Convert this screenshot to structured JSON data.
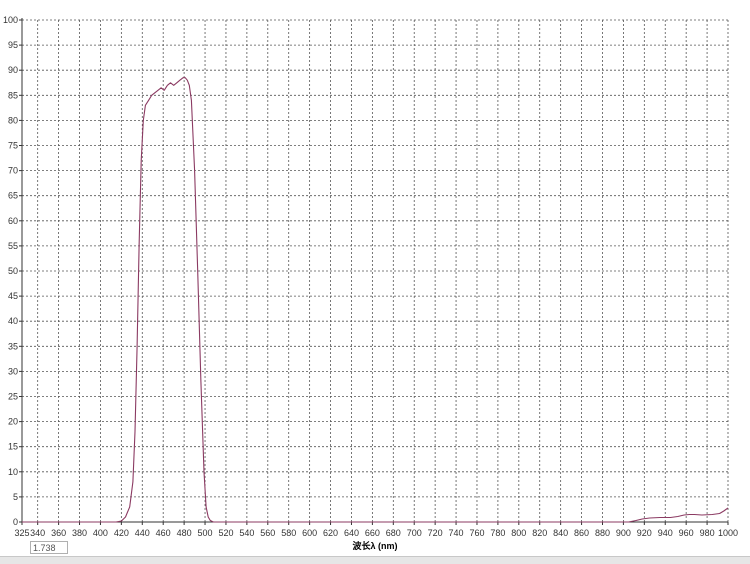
{
  "chart_data": {
    "type": "line",
    "title": "",
    "xlabel": "波长λ (nm)",
    "ylabel": "",
    "xlim": [
      325,
      1000
    ],
    "ylim": [
      0,
      100
    ],
    "grid": true,
    "grid_style": "dotted",
    "x_ticks": [
      325,
      340,
      360,
      380,
      400,
      420,
      440,
      460,
      480,
      500,
      520,
      540,
      560,
      580,
      600,
      620,
      640,
      660,
      680,
      700,
      720,
      740,
      760,
      780,
      800,
      820,
      840,
      860,
      880,
      900,
      920,
      940,
      960,
      980,
      1000
    ],
    "x_tick_labels": [
      "325",
      "340",
      "360",
      "380",
      "400",
      "420",
      "440",
      "460",
      "480",
      "500",
      "520",
      "540",
      "560",
      "580",
      "600",
      "620",
      "640",
      "660",
      "680",
      "700",
      "720",
      "740",
      "760",
      "780",
      "800",
      "820",
      "840",
      "860",
      "880",
      "900",
      "920",
      "940",
      "960",
      "980",
      "1000"
    ],
    "y_ticks": [
      0,
      5,
      10,
      15,
      20,
      25,
      30,
      35,
      40,
      45,
      50,
      55,
      60,
      65,
      70,
      75,
      80,
      85,
      90,
      95,
      100
    ],
    "y_tick_labels": [
      "0",
      "5",
      "10",
      "15",
      "20",
      "25",
      "30",
      "35",
      "40",
      "45",
      "50",
      "55",
      "60",
      "65",
      "70",
      "75",
      "80",
      "85",
      "90",
      "95",
      "100"
    ],
    "line_color": "#8b3a62",
    "series": [
      {
        "x": [
          325,
          400,
          415,
          420,
          424,
          428,
          431,
          433,
          435,
          437,
          439,
          441,
          443,
          446,
          449,
          452,
          455,
          458,
          461,
          464,
          467,
          470,
          473,
          476,
          479,
          481,
          483,
          485,
          487,
          490,
          493,
          496,
          499,
          501,
          503,
          505,
          508,
          512,
          520,
          600,
          700,
          800,
          880,
          905,
          912,
          918,
          925,
          935,
          945,
          952,
          958,
          963,
          968,
          975,
          985,
          992,
          996,
          1000
        ],
        "y": [
          0,
          0,
          0,
          0.2,
          1,
          3,
          8,
          18,
          35,
          55,
          72,
          80,
          83,
          84,
          85,
          85.5,
          86,
          86.5,
          86,
          87,
          87.5,
          87,
          87.5,
          88,
          88.5,
          88.5,
          88,
          87,
          84,
          70,
          50,
          28,
          10,
          3,
          1,
          0.3,
          0,
          0,
          0,
          0,
          0,
          0,
          0,
          0,
          0.3,
          0.6,
          0.8,
          0.9,
          0.9,
          1.1,
          1.4,
          1.5,
          1.5,
          1.4,
          1.5,
          1.7,
          2.2,
          2.8
        ]
      }
    ]
  },
  "readout": {
    "value": "1.738"
  },
  "colors": {
    "grid": "#555555",
    "axis": "#333333",
    "background": "#ffffff"
  }
}
